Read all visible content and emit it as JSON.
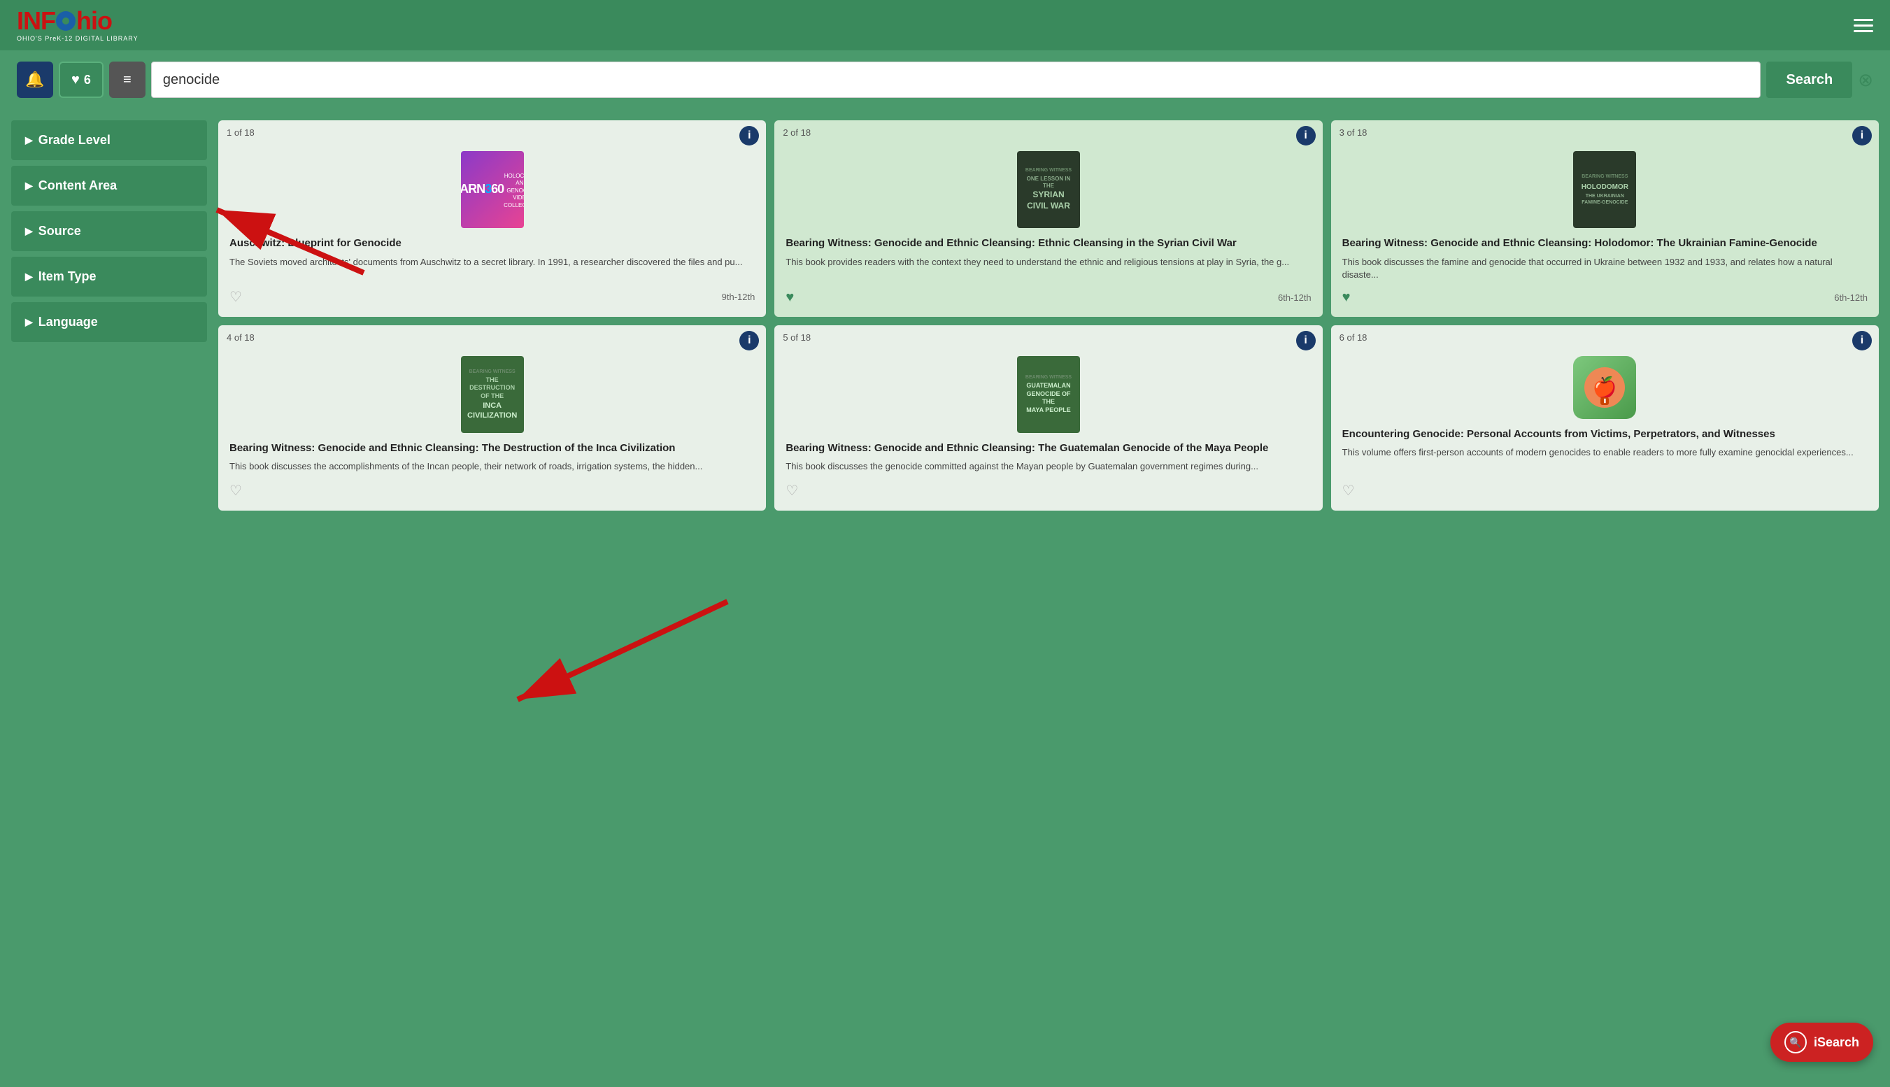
{
  "header": {
    "logo": "INFOhio",
    "subtitle": "OHIO'S PreK-12 DIGITAL LIBRARY",
    "hamburger_label": "menu"
  },
  "toolbar": {
    "bell_label": "🔔",
    "favorites_count": "6",
    "favorites_heart": "♥",
    "list_icon": "≡",
    "search_value": "genocide",
    "search_placeholder": "Search...",
    "search_button": "Search",
    "clear_button": "⊗"
  },
  "sidebar": {
    "filters": [
      {
        "label": "Grade Level"
      },
      {
        "label": "Content Area"
      },
      {
        "label": "Source"
      },
      {
        "label": "Item Type"
      },
      {
        "label": "Language"
      }
    ]
  },
  "results": {
    "cards": [
      {
        "counter": "1 of 18",
        "title": "Auschwitz: Blueprint for Genocide",
        "desc": "The Soviets moved architects' documents from Auschwitz to a secret library. In 1991, a researcher discovered the files and pu...",
        "grade": "9th-12th",
        "heart": "empty",
        "thumb_type": "learn360"
      },
      {
        "counter": "2 of 18",
        "title": "Bearing Witness: Genocide and Ethnic Cleansing: Ethnic Cleansing in the Syrian Civil War",
        "desc": "This book provides readers with the context they need to understand the ethnic and religious tensions at play in Syria, the g...",
        "grade": "6th-12th",
        "heart": "filled",
        "thumb_type": "book_dark",
        "thumb_label": "BEARING WITNESS\nONE LESSON IN THE\nSYRIAN\nCIVIL WAR"
      },
      {
        "counter": "3 of 18",
        "title": "Bearing Witness: Genocide and Ethnic Cleansing: Holodomor: The Ukrainian Famine-Genocide",
        "desc": "This book discusses the famine and genocide that occurred in Ukraine between 1932 and 1933, and relates how a natural disaste...",
        "grade": "6th-12th",
        "heart": "filled",
        "thumb_type": "book_dark",
        "thumb_label": "HOLODOMOR\nTHE UKRAINIAN FAMINE-GENOCIDE"
      },
      {
        "counter": "4 of 18",
        "title": "Bearing Witness: Genocide and Ethnic Cleansing: The Destruction of the Inca Civilization",
        "desc": "This book discusses the accomplishments of the Incan people, their network of roads, irrigation systems, the hidden...",
        "grade": "",
        "heart": "empty",
        "thumb_type": "book_green",
        "thumb_label": "BEARING WITNESS\nTHE DESTRUCTION OF THE\nINCA\nCIVILIZATION"
      },
      {
        "counter": "5 of 18",
        "title": "Bearing Witness: Genocide and Ethnic Cleansing: The Guatemalan Genocide of the Maya People",
        "desc": "This book discusses the genocide committed against the Mayan people by Guatemalan government regimes during...",
        "grade": "",
        "heart": "empty",
        "thumb_type": "book_green",
        "thumb_label": "BEARING WITNESS\nGUATEMALAN\nGENOCIDE OF THE\nMAYA PEOPLE"
      },
      {
        "counter": "6 of 18",
        "title": "Encountering Genocide: Personal Accounts from Victims, Perpetrators, and Witnesses",
        "desc": "This volume offers first-person accounts of modern genocides to enable readers to more fully examine genocidal experiences...",
        "grade": "",
        "heart": "empty",
        "thumb_type": "app",
        "thumb_label": "🍎"
      }
    ]
  },
  "isearch": {
    "label": "iSearch",
    "icon": "🔍"
  }
}
